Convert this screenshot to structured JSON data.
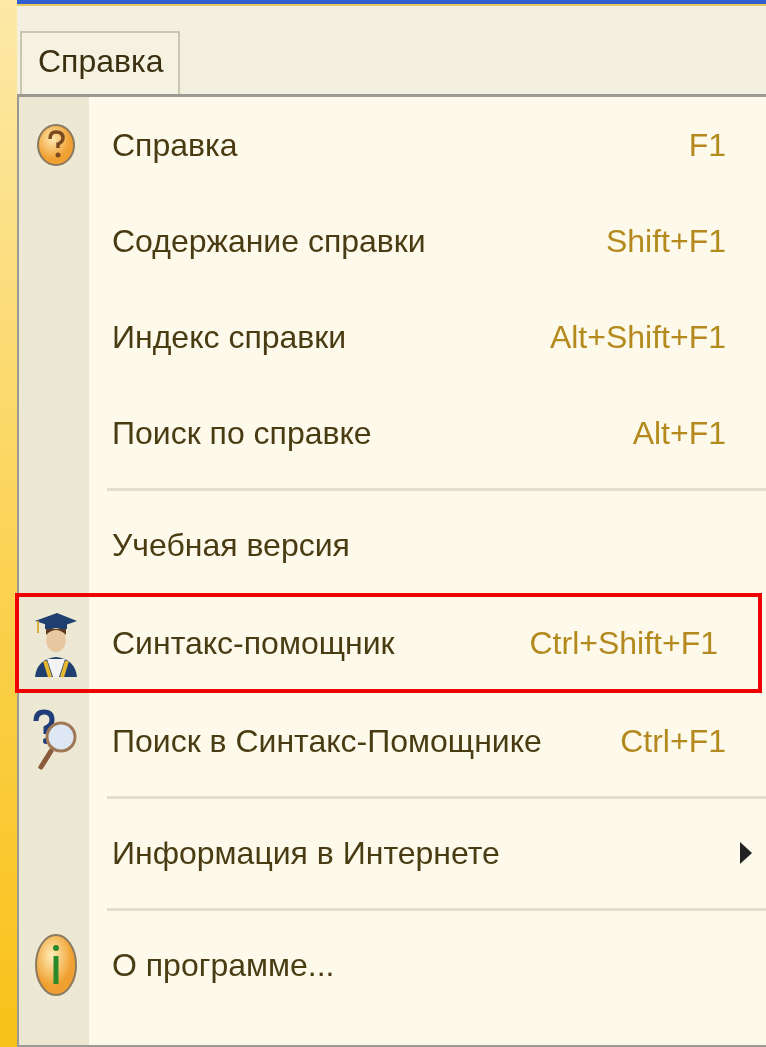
{
  "menu_bar": {
    "tabs": [
      {
        "label": "Справка",
        "selected": true
      }
    ]
  },
  "menu": {
    "items": [
      {
        "kind": "help",
        "label": "Справка",
        "shortcut": "F1",
        "highlighted": false
      },
      {
        "kind": "text",
        "label": "Содержание справки",
        "shortcut": "Shift+F1",
        "highlighted": false
      },
      {
        "kind": "text",
        "label": "Индекс справки",
        "shortcut": "Alt+Shift+F1",
        "highlighted": false
      },
      {
        "kind": "text",
        "label": "Поиск по справке",
        "shortcut": "Alt+F1",
        "highlighted": false
      },
      {
        "kind": "separator"
      },
      {
        "kind": "text",
        "label": "Учебная версия",
        "highlighted": false
      },
      {
        "kind": "assistant",
        "label": "Синтакс-помощник",
        "shortcut": "Ctrl+Shift+F1",
        "highlighted": true
      },
      {
        "kind": "search",
        "label": "Поиск в Синтакс-Помощнике",
        "shortcut": "Ctrl+F1",
        "highlighted": false
      },
      {
        "kind": "separator"
      },
      {
        "kind": "submenu",
        "label": "Информация в Интернете",
        "highlighted": false
      },
      {
        "kind": "separator"
      },
      {
        "kind": "info",
        "label": "О программе...",
        "highlighted": false
      }
    ]
  }
}
